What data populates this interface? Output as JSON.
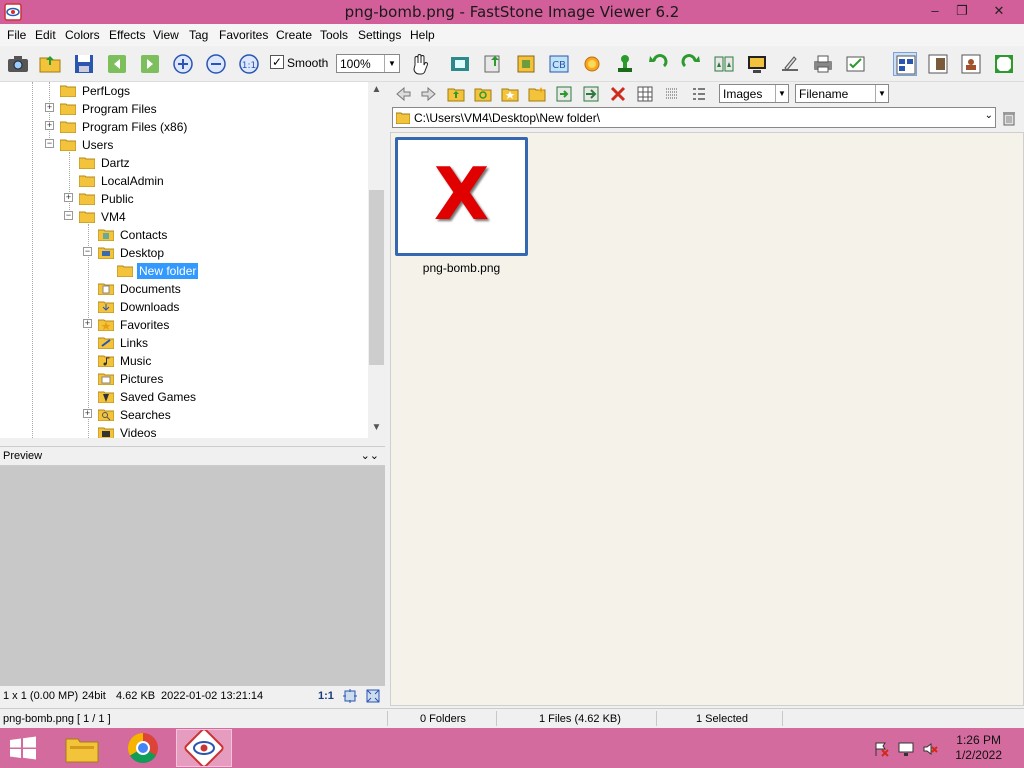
{
  "window": {
    "title": "png-bomb.png  -  FastStone Image Viewer 6.2",
    "minimize": "–",
    "restore": "❐",
    "close": "✕"
  },
  "menu": [
    "File",
    "Edit",
    "Colors",
    "Effects",
    "View",
    "Tag",
    "Favorites",
    "Create",
    "Tools",
    "Settings",
    "Help"
  ],
  "toolbar": {
    "smooth_checked": "✓",
    "smooth_label": "Smooth",
    "zoom_value": "100%",
    "dropdown_arrow": "▼"
  },
  "tree": {
    "nodes": [
      {
        "label": "PerfLogs"
      },
      {
        "label": "Program Files"
      },
      {
        "label": "Program Files (x86)"
      },
      {
        "label": "Users"
      },
      {
        "label": "Dartz"
      },
      {
        "label": "LocalAdmin"
      },
      {
        "label": "Public"
      },
      {
        "label": "VM4"
      },
      {
        "label": "Contacts"
      },
      {
        "label": "Desktop"
      },
      {
        "label": "New folder"
      },
      {
        "label": "Documents"
      },
      {
        "label": "Downloads"
      },
      {
        "label": "Favorites"
      },
      {
        "label": "Links"
      },
      {
        "label": "Music"
      },
      {
        "label": "Pictures"
      },
      {
        "label": "Saved Games"
      },
      {
        "label": "Searches"
      },
      {
        "label": "Videos"
      }
    ],
    "expand_plus": "+",
    "expand_minus": "−",
    "scroll_up": "▲",
    "scroll_down": "▼"
  },
  "preview": {
    "title": "Preview",
    "collapse": "⌄⌄",
    "info": {
      "dimensions": "1 x 1 (0.00 MP)",
      "bitdepth": "24bit",
      "size": "4.62 KB",
      "date": "2022-01-02 13:21:14",
      "ratio": "1:1"
    }
  },
  "browser": {
    "filter": "Images",
    "sort": "Filename",
    "path": "C:\\Users\\VM4\\Desktop\\New folder\\",
    "path_arrow": "⌄",
    "thumbnail": {
      "name": "png-bomb.png",
      "broken_glyph": "X"
    }
  },
  "status": {
    "file": "png-bomb.png [ 1 / 1 ]",
    "folders": "0 Folders",
    "files": "1 Files (4.62 KB)",
    "selected": "1 Selected"
  },
  "taskbar": {
    "time": "1:26 PM",
    "date": "1/2/2022"
  },
  "colors": {
    "titlebar": "#d25e9a",
    "taskbar": "#d46b9e",
    "selection": "#3399ff",
    "thumb_border": "#3568b3",
    "broken_x": "#e00000"
  }
}
